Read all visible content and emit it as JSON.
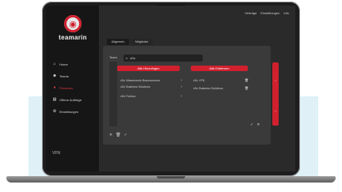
{
  "topbar": {
    "items": [
      "Verträge",
      "Einstellungen",
      "Info"
    ]
  },
  "sidebar": {
    "brand": "teamarin",
    "items": [
      {
        "label": "Home",
        "icon": "home-icon",
        "glyph": "⌂"
      },
      {
        "label": "Teams",
        "icon": "users-icon",
        "glyph": "☻"
      },
      {
        "label": "Personen",
        "icon": "person-icon",
        "glyph": "●",
        "active": true
      },
      {
        "label": "Offene Aufträge",
        "icon": "document-icon",
        "glyph": "▤"
      },
      {
        "label": "Einstellungen",
        "icon": "gear-icon",
        "glyph": "⚙"
      }
    ],
    "footer_logo": "VFN"
  },
  "tabs": [
    "Allgemein",
    "Mitglieder"
  ],
  "panel": {
    "label": "Team",
    "search_value": "vDc",
    "add_all_button": "Alle Hinzufügen",
    "remove_all_button": "Alle Entfernen",
    "available": [
      "vDc Wasserwerk Braunsommer",
      "vDc Business Solutions",
      "vDc Fontour"
    ],
    "selected": [
      "vDc VFN",
      "vDc Business Solutions"
    ]
  },
  "colors": {
    "accent": "#d0202e",
    "sidebar": "#161616",
    "panel": "#3a3a3a"
  }
}
